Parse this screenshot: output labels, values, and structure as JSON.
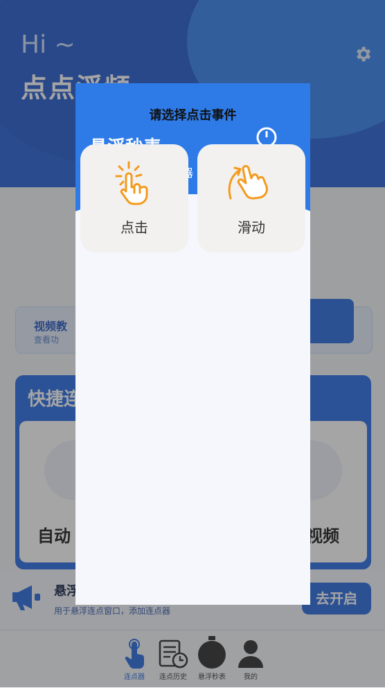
{
  "app": {
    "greeting": "Hi ~",
    "title": "点点浮频",
    "banner": {
      "title": "视频教",
      "subtitle": "查看功"
    },
    "quick": {
      "title": "快捷连",
      "left_label": "自动",
      "right_label": "视频"
    },
    "notice": {
      "title": "悬浮",
      "subtitle": "用于悬浮连点窗口，添加连点器",
      "button": "去开启"
    },
    "tabs": [
      {
        "label": "连点器",
        "icon": "tap-hand-icon",
        "active": true
      },
      {
        "label": "连点历史",
        "icon": "history-icon",
        "active": false
      },
      {
        "label": "悬浮秒表",
        "icon": "stopwatch-icon",
        "active": false
      },
      {
        "label": "我的",
        "icon": "user-icon",
        "active": false
      }
    ]
  },
  "dialog": {
    "title": "请选择点击事件",
    "background_title": "悬浮秒表",
    "background_sub": "器",
    "options": [
      {
        "label": "点击",
        "icon": "tap-icon"
      },
      {
        "label": "滑动",
        "icon": "swipe-icon"
      }
    ]
  },
  "colors": {
    "accent": "#2d6fe0",
    "icon_orange": "#f39a1d",
    "option_bg": "#f2f1ef"
  }
}
